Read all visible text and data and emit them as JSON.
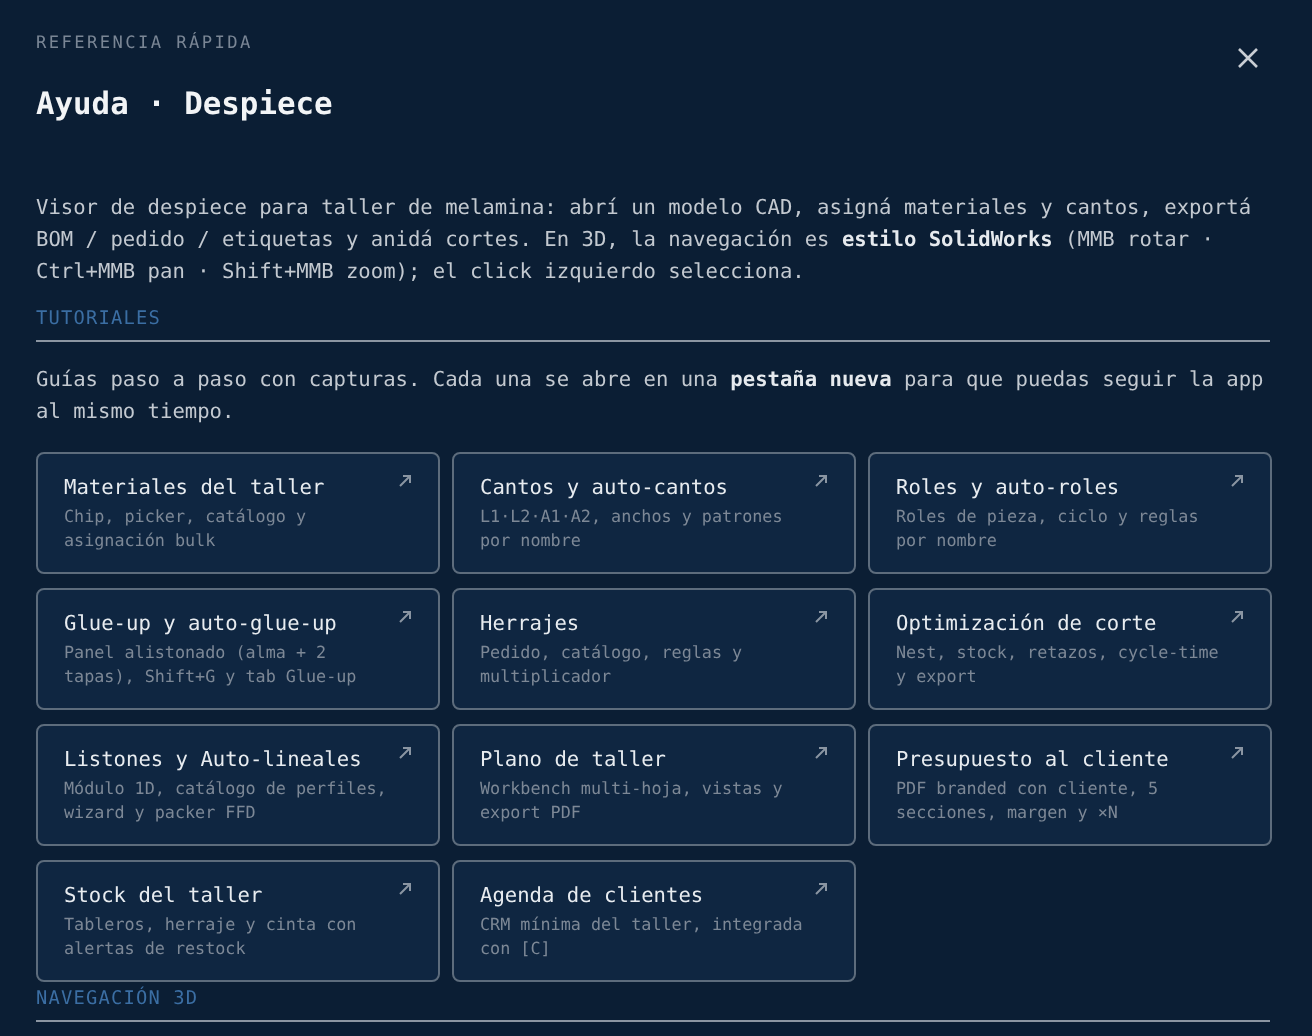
{
  "header": {
    "eyebrow": "REFERENCIA RÁPIDA",
    "title": "Ayuda · Despiece"
  },
  "intro": "Visor de despiece para taller de melamina: abrí un modelo CAD, asigná materiales y cantos, exportá BOM / pedido / etiquetas y anidá cortes. En 3D, la navegación es **estilo SolidWorks** (MMB rotar · Ctrl+MMB pan · Shift+MMB zoom); el click izquierdo selecciona.",
  "sections": [
    {
      "heading": "TUTORIALES",
      "text": "Guías paso a paso con capturas. Cada una se abre en una **pestaña nueva** para que puedas seguir la app al mismo tiempo.",
      "cards": [
        {
          "title": "Materiales del taller",
          "description": "Chip, picker, catálogo y asignación bulk"
        },
        {
          "title": "Cantos y auto-cantos",
          "description": "L1·L2·A1·A2, anchos y patrones por nombre"
        },
        {
          "title": "Roles y auto-roles",
          "description": "Roles de pieza, ciclo y reglas por nombre"
        },
        {
          "title": "Glue-up y auto-glue-up",
          "description": "Panel alistonado (alma + 2 tapas), Shift+G y tab Glue-up"
        },
        {
          "title": "Herrajes",
          "description": "Pedido, catálogo, reglas y multiplicador"
        },
        {
          "title": "Optimización de corte",
          "description": "Nest, stock, retazos, cycle-time y export"
        },
        {
          "title": "Listones y Auto-lineales",
          "description": "Módulo 1D, catálogo de perfiles, wizard y packer FFD"
        },
        {
          "title": "Plano de taller",
          "description": "Workbench multi-hoja, vistas y export PDF"
        },
        {
          "title": "Presupuesto al cliente",
          "description": "PDF branded con cliente, 5 secciones, margen y ×N"
        },
        {
          "title": "Stock del taller",
          "description": "Tableros, herraje y cinta con alertas de restock"
        },
        {
          "title": "Agenda de clientes",
          "description": "CRM mínima del taller, integrada con [C]"
        }
      ]
    },
    {
      "heading": "NAVEGACIÓN 3D"
    }
  ]
}
